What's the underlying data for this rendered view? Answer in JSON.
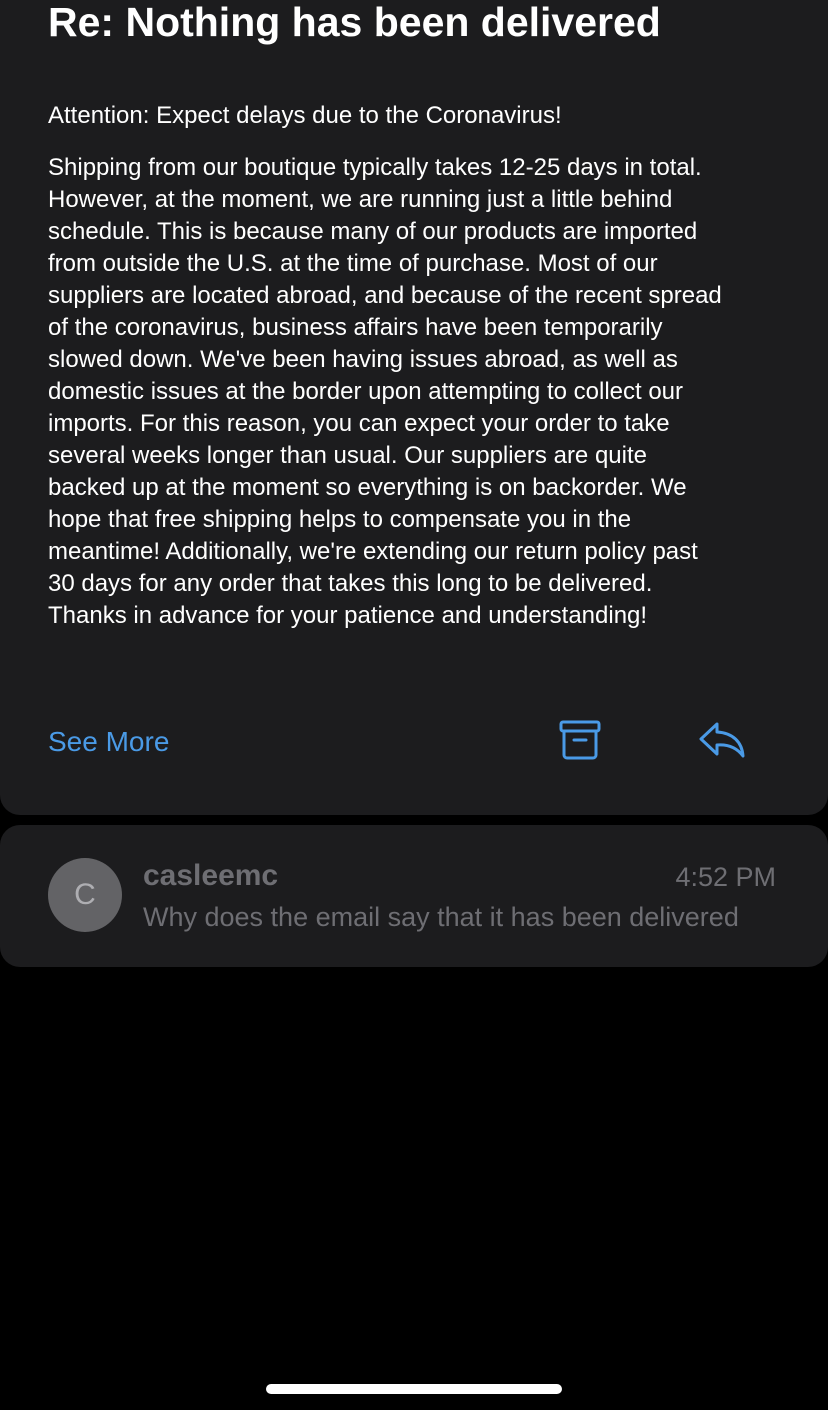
{
  "email": {
    "subject": "Re:  Nothing has been delivered",
    "attention": "Attention: Expect delays due to the Coronavirus!",
    "body_lines": [
      "Shipping from our boutique typically takes 12-25 days in total.",
      "However, at the moment, we are running just a little behind",
      "schedule. This is because many of our products are imported",
      "from outside the U.S. at the time of purchase. Most of our",
      "suppliers are located abroad, and because of the recent spread",
      "of the coronavirus, business affairs have been temporarily",
      "slowed down. We've been having issues abroad, as well as",
      "domestic issues at the border upon attempting to collect our",
      "imports. For this reason, you can expect your order to take",
      "several weeks longer than usual. Our suppliers are quite",
      "backed up at the moment so everything is on backorder. We",
      "hope that free shipping helps to compensate you in the",
      "meantime! Additionally, we're extending our return policy past",
      "30 days for any order that takes this long to be delivered.",
      "Thanks in advance for your patience and understanding!"
    ],
    "see_more_label": "See More",
    "actions": {
      "archive_icon": "archive-icon",
      "reply_icon": "reply-icon"
    }
  },
  "thread_item": {
    "avatar_initial": "C",
    "sender": "casleemc",
    "time": "4:52 PM",
    "preview": "Why does the email say that it has been delivered"
  },
  "colors": {
    "background": "#000000",
    "card": "#1c1c1e",
    "accent": "#4a9ae6",
    "muted_text": "#6e6e73",
    "avatar": "#636366"
  }
}
